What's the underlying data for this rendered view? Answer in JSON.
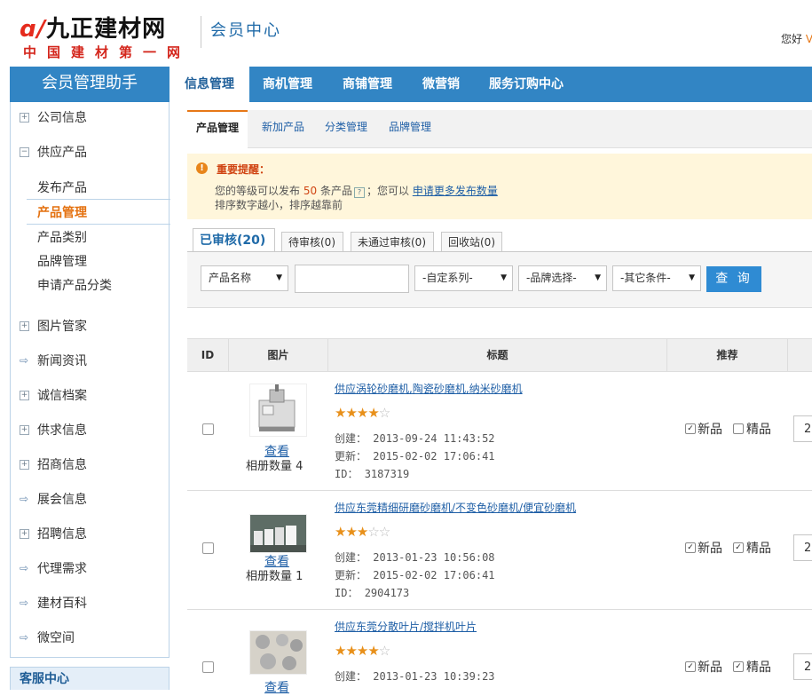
{
  "header": {
    "logo_main": "九正建材网",
    "logo_sub": "中国建材第一网",
    "member_center": "会员中心",
    "greeting": "您好",
    "greeting_user": "V"
  },
  "sidebar": {
    "title": "会员管理助手",
    "items": [
      {
        "label": "公司信息",
        "icon": "plus-box-icon"
      },
      {
        "label": "供应产品",
        "icon": "minus-box-icon"
      },
      {
        "label": "图片管家",
        "icon": "plus-box-icon"
      },
      {
        "label": "新闻资讯",
        "icon": "arrow-right-icon"
      },
      {
        "label": "诚信档案",
        "icon": "plus-box-icon"
      },
      {
        "label": "供求信息",
        "icon": "plus-box-icon"
      },
      {
        "label": "招商信息",
        "icon": "plus-box-icon"
      },
      {
        "label": "展会信息",
        "icon": "arrow-right-icon"
      },
      {
        "label": "招聘信息",
        "icon": "plus-box-icon"
      },
      {
        "label": "代理需求",
        "icon": "arrow-right-icon"
      },
      {
        "label": "建材百科",
        "icon": "arrow-right-icon"
      },
      {
        "label": "微空间",
        "icon": "arrow-right-icon"
      }
    ],
    "sub_items": [
      "发布产品",
      "产品管理",
      "产品类别",
      "品牌管理",
      "申请产品分类"
    ],
    "kefu": "客服中心"
  },
  "topnav": [
    "信息管理",
    "商机管理",
    "商铺管理",
    "微营销",
    "服务订购中心"
  ],
  "subtabs": [
    "产品管理",
    "新加产品",
    "分类管理",
    "品牌管理"
  ],
  "notice": {
    "title": "重要提醒：",
    "line1_a": "您的等级可以发布",
    "line1_num": "50",
    "line1_b": "条产品",
    "line1_c": "；您可以",
    "line1_link": "申请更多发布数量",
    "line2": "排序数字越小，排序越靠前",
    "help_glyph": "?"
  },
  "status_tabs": [
    "已审核(20)",
    "待审核(0)",
    "未通过审核(0)",
    "回收站(0)"
  ],
  "filter": {
    "field": "产品名称",
    "series": "-自定系列-",
    "brand": "-品牌选择-",
    "other": "-其它条件-",
    "search": "查 询"
  },
  "table": {
    "headers": [
      "ID",
      "图片",
      "标题",
      "推荐"
    ],
    "view_label": "查看",
    "album_label": "相册数量",
    "created_label": "创建：",
    "updated_label": "更新：",
    "id_label": "ID：",
    "new_label": "新品",
    "fine_label": "精品",
    "rows": [
      {
        "title": "供应涡轮砂磨机,陶瓷砂磨机,纳米砂磨机",
        "rating": 4,
        "created": "2013-09-24 11:43:52",
        "updated": "2015-02-02 17:06:41",
        "id": "3187319",
        "album": "4",
        "is_new": true,
        "is_fine": false,
        "sort": "2"
      },
      {
        "title": "供应东莞精细研磨砂磨机/不变色砂磨机/便宜砂磨机",
        "rating": 3,
        "created": "2013-01-23 10:56:08",
        "updated": "2015-02-02 17:06:41",
        "id": "2904173",
        "album": "1",
        "is_new": true,
        "is_fine": true,
        "sort": "2"
      },
      {
        "title": "供应东莞分散叶片/搅拌机叶片",
        "rating": 4,
        "created": "2013-01-23 10:39:23",
        "updated": "",
        "id": "",
        "album": "",
        "is_new": true,
        "is_fine": true,
        "sort": "2"
      }
    ]
  },
  "colors": {
    "nav_blue": "#3285c4",
    "accent_orange": "#e77817",
    "link_blue": "#1f5fa6"
  }
}
